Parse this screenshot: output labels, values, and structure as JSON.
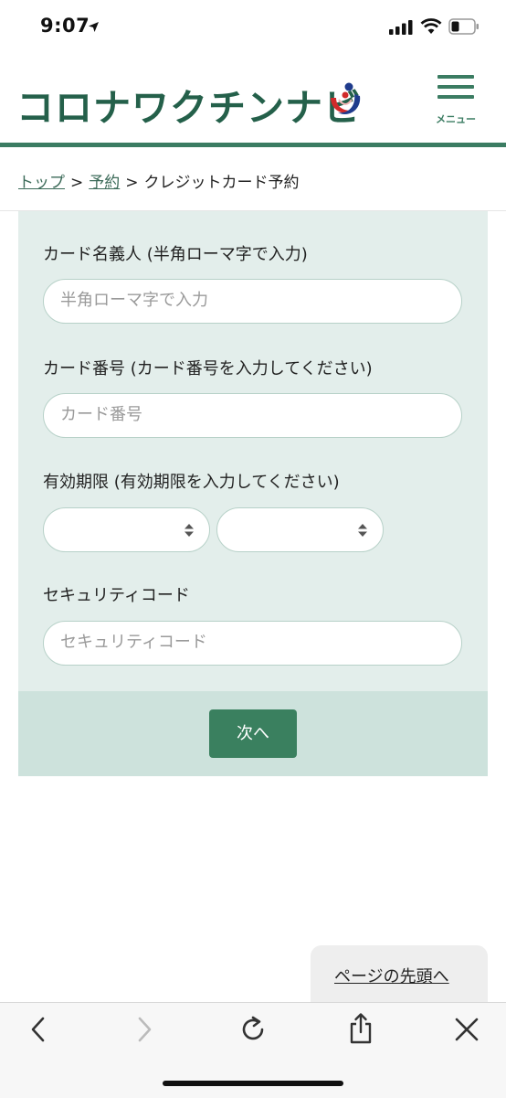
{
  "status_bar": {
    "time": "9:07",
    "icons": [
      "location-arrow-icon",
      "cellular-signal-icon",
      "wifi-icon",
      "battery-icon"
    ]
  },
  "header": {
    "logo_text": "コロナワクチンナビ",
    "logo_icon": "mhlw-logo-icon",
    "menu_label": "メニュー",
    "brand_color": "#24604a",
    "accent_color": "#3b7c62"
  },
  "breadcrumb": {
    "items": [
      {
        "label": "トップ",
        "link": true
      },
      {
        "label": "予約",
        "link": true
      },
      {
        "label": "クレジットカード予約",
        "link": false
      }
    ],
    "separator": ">"
  },
  "form": {
    "cardholder": {
      "label": "カード名義人 (半角ローマ字で入力)",
      "placeholder": "半角ローマ字で入力",
      "value": ""
    },
    "card_number": {
      "label": "カード番号 (カード番号を入力してください)",
      "placeholder": "カード番号",
      "value": ""
    },
    "expiry": {
      "label": "有効期限 (有効期限を入力してください)",
      "month_value": "",
      "year_value": ""
    },
    "security_code": {
      "label": "セキュリティコード",
      "placeholder": "セキュリティコード",
      "value": ""
    },
    "next_label": "次へ"
  },
  "page_top_label": "ページの先頭へ",
  "browser_toolbar": {
    "icons": [
      "back-arrow-icon",
      "forward-arrow-icon",
      "reload-icon",
      "share-icon",
      "close-icon"
    ]
  }
}
